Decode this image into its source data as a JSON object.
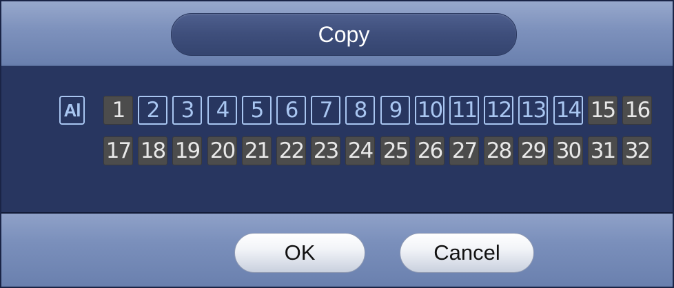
{
  "dialog": {
    "title": "Copy",
    "all_label": "Al",
    "channels": [
      {
        "label": "1",
        "checked": false
      },
      {
        "label": "2",
        "checked": true
      },
      {
        "label": "3",
        "checked": true
      },
      {
        "label": "4",
        "checked": true
      },
      {
        "label": "5",
        "checked": true
      },
      {
        "label": "6",
        "checked": true
      },
      {
        "label": "7",
        "checked": true
      },
      {
        "label": "8",
        "checked": true
      },
      {
        "label": "9",
        "checked": true
      },
      {
        "label": "10",
        "checked": true
      },
      {
        "label": "11",
        "checked": true
      },
      {
        "label": "12",
        "checked": true
      },
      {
        "label": "13",
        "checked": true
      },
      {
        "label": "14",
        "checked": true
      },
      {
        "label": "15",
        "checked": false
      },
      {
        "label": "16",
        "checked": false
      },
      {
        "label": "17",
        "checked": false
      },
      {
        "label": "18",
        "checked": false
      },
      {
        "label": "19",
        "checked": false
      },
      {
        "label": "20",
        "checked": false
      },
      {
        "label": "21",
        "checked": false
      },
      {
        "label": "22",
        "checked": false
      },
      {
        "label": "23",
        "checked": false
      },
      {
        "label": "24",
        "checked": false
      },
      {
        "label": "25",
        "checked": false
      },
      {
        "label": "26",
        "checked": false
      },
      {
        "label": "27",
        "checked": false
      },
      {
        "label": "28",
        "checked": false
      },
      {
        "label": "29",
        "checked": false
      },
      {
        "label": "30",
        "checked": false
      },
      {
        "label": "31",
        "checked": false
      },
      {
        "label": "32",
        "checked": false
      }
    ],
    "ok_label": "OK",
    "cancel_label": "Cancel"
  },
  "colors": {
    "checked": "#a9c6f1",
    "unchecked_bg": "#4c4c4c",
    "content_bg": "#283660"
  }
}
